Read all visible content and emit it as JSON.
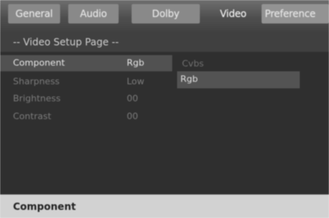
{
  "tabs": [
    {
      "label": "General",
      "state": "inactive"
    },
    {
      "label": "Audio",
      "state": "inactive"
    },
    {
      "label": "Dolby",
      "state": "inactive"
    },
    {
      "label": "Video",
      "state": "active"
    },
    {
      "label": "Preference",
      "state": "inactive"
    }
  ],
  "page_title": "-- Video Setup Page --",
  "settings": [
    {
      "label": "Component",
      "value": "Rgb",
      "selected": true
    },
    {
      "label": "Sharpness",
      "value": "Low",
      "selected": false
    },
    {
      "label": "Brightness",
      "value": "00",
      "selected": false
    },
    {
      "label": "Contrast",
      "value": "00",
      "selected": false
    }
  ],
  "component_options": [
    {
      "label": "Cvbs",
      "highlighted": false
    },
    {
      "label": "Rgb",
      "highlighted": true
    }
  ],
  "status_bar": {
    "text": "Component"
  },
  "colors": {
    "screen_bg": "#282828",
    "selection_bg": "#4d4d4d",
    "inactive_tab_bg": "#8a8a8a",
    "status_bar_bg": "#d9d9d9"
  }
}
